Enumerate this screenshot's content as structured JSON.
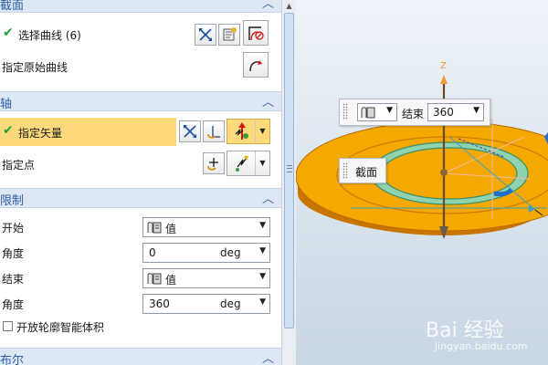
{
  "sections": {
    "section": {
      "title": "截面",
      "select_curve_label": "选择曲线 (6)",
      "origin_curve_label": "指定原始曲线"
    },
    "axis": {
      "title": "轴",
      "vector_label": "指定矢量",
      "point_label": "指定点"
    },
    "limits": {
      "title": "限制",
      "start_label": "开始",
      "start_mode": "值",
      "start_angle_label": "角度",
      "start_angle_value": "0",
      "start_angle_unit": "deg",
      "end_label": "结束",
      "end_mode": "值",
      "end_angle_label": "角度",
      "end_angle_value": "360",
      "end_angle_unit": "deg",
      "open_profile_label": "开放轮廓智能体积"
    },
    "boolean": {
      "title": "布尔"
    }
  },
  "viewport": {
    "floating_end_label": "结束",
    "floating_end_value": "360",
    "floating_section_label": "截面",
    "z_axis_label": "Z"
  },
  "watermark": {
    "brand": "Bai 经验",
    "url": "jingyan.baidu.com"
  },
  "colors": {
    "group_header_bg": "#dde8f4",
    "group_title": "#2f5fa8",
    "highlight_row": "#fcd97a",
    "disc_orange": "#f5a800",
    "ring_green": "#8fd2b0"
  }
}
